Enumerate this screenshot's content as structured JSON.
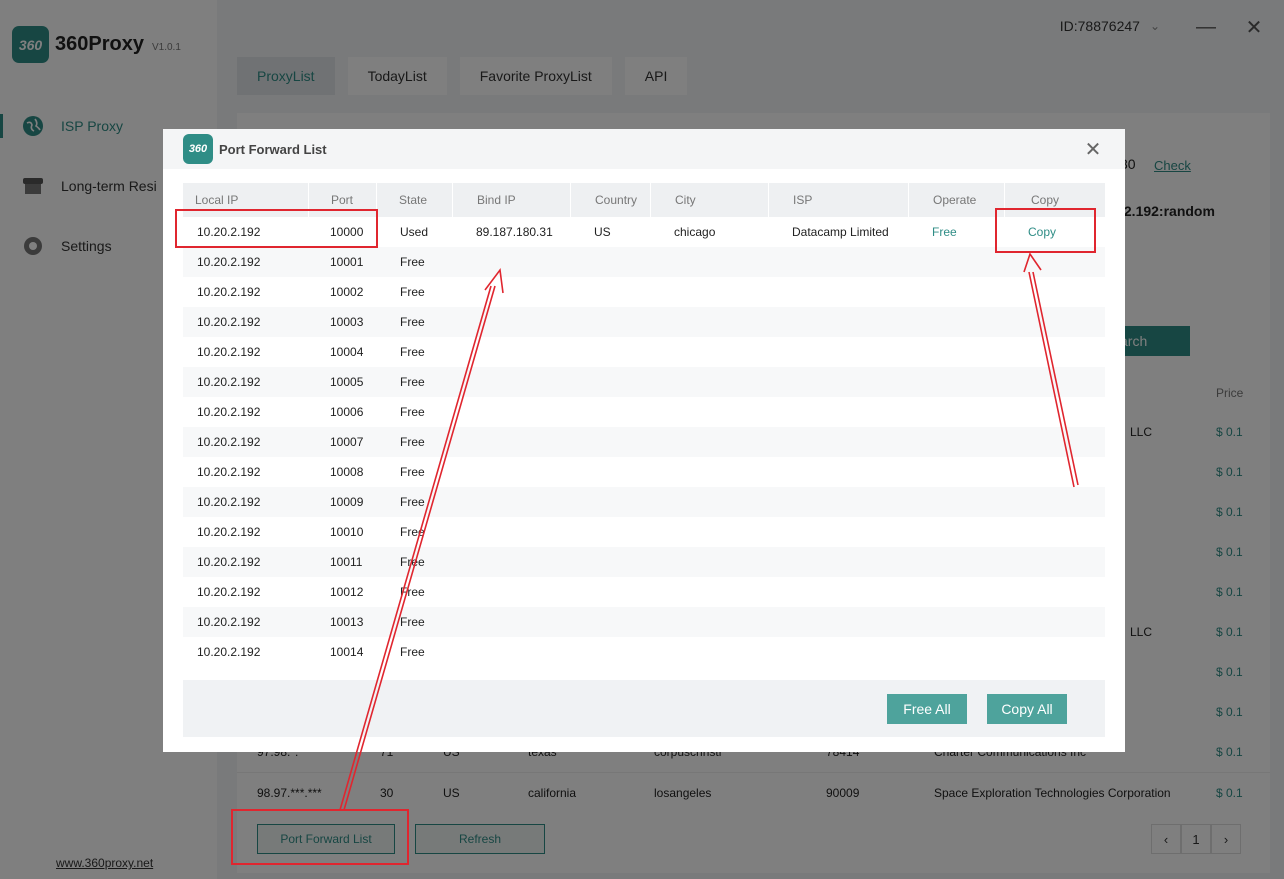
{
  "app": {
    "logo_mark": "360",
    "name": "360Proxy",
    "version": "V1.0.1",
    "site_link": "www.360proxy.net",
    "account_id": "ID:78876247",
    "accent_color": "#2f8d86"
  },
  "sidebar": {
    "items": [
      {
        "label": "ISP Proxy",
        "icon": "globe-icon",
        "active": true
      },
      {
        "label": "Long-term Resi",
        "icon": "store-icon",
        "active": false
      },
      {
        "label": "Settings",
        "icon": "gear-icon",
        "active": false
      }
    ]
  },
  "tabs": [
    {
      "label": "ProxyList",
      "active": true
    },
    {
      "label": "TodayList",
      "active": false
    },
    {
      "label": "Favorite ProxyList",
      "active": false
    },
    {
      "label": "API",
      "active": false
    }
  ],
  "background": {
    "partial_number": "30",
    "check_link": "Check",
    "partial_ip": ".2.192:random",
    "search_label": "arch",
    "price_header": "Price",
    "isp_partial_1": "LLC",
    "isp_partial_2": "LLC",
    "prices": [
      "$ 0.1",
      "$ 0.1",
      "$ 0.1",
      "$ 0.1",
      "$ 0.1",
      "$ 0.1",
      "$ 0.1",
      "$ 0.1",
      "$ 0.1",
      "$ 0.1"
    ],
    "row_texas": {
      "ip": "97.98.*.*",
      "port": "71",
      "country": "US",
      "state": "texas",
      "city": "corpuschristi",
      "zip": "78414",
      "isp": "Charter Communications Inc"
    },
    "row_california": {
      "ip": "98.97.***.***",
      "port": "30",
      "country": "US",
      "state": "california",
      "city": "losangeles",
      "zip": "90009",
      "isp": "Space Exploration Technologies Corporation",
      "price": "$ 0.1"
    },
    "port_forward_button": "Port Forward List",
    "refresh_button": "Refresh",
    "page_number": "1"
  },
  "modal": {
    "logo_mark": "360",
    "title": "Port Forward List",
    "columns": [
      "Local IP",
      "Port",
      "State",
      "Bind IP",
      "Country",
      "City",
      "ISP",
      "Operate",
      "Copy"
    ],
    "rows": [
      {
        "local_ip": "10.20.2.192",
        "port": "10000",
        "state": "Used",
        "bind_ip": "89.187.180.31",
        "country": "US",
        "city": "chicago",
        "isp": "Datacamp Limited",
        "operate": "Free",
        "copy": "Copy"
      },
      {
        "local_ip": "10.20.2.192",
        "port": "10001",
        "state": "Free"
      },
      {
        "local_ip": "10.20.2.192",
        "port": "10002",
        "state": "Free"
      },
      {
        "local_ip": "10.20.2.192",
        "port": "10003",
        "state": "Free"
      },
      {
        "local_ip": "10.20.2.192",
        "port": "10004",
        "state": "Free"
      },
      {
        "local_ip": "10.20.2.192",
        "port": "10005",
        "state": "Free"
      },
      {
        "local_ip": "10.20.2.192",
        "port": "10006",
        "state": "Free"
      },
      {
        "local_ip": "10.20.2.192",
        "port": "10007",
        "state": "Free"
      },
      {
        "local_ip": "10.20.2.192",
        "port": "10008",
        "state": "Free"
      },
      {
        "local_ip": "10.20.2.192",
        "port": "10009",
        "state": "Free"
      },
      {
        "local_ip": "10.20.2.192",
        "port": "10010",
        "state": "Free"
      },
      {
        "local_ip": "10.20.2.192",
        "port": "10011",
        "state": "Free"
      },
      {
        "local_ip": "10.20.2.192",
        "port": "10012",
        "state": "Free"
      },
      {
        "local_ip": "10.20.2.192",
        "port": "10013",
        "state": "Free"
      },
      {
        "local_ip": "10.20.2.192",
        "port": "10014",
        "state": "Free"
      }
    ],
    "free_all_button": "Free All",
    "copy_all_button": "Copy All"
  },
  "annotation_color": "#e0262f"
}
